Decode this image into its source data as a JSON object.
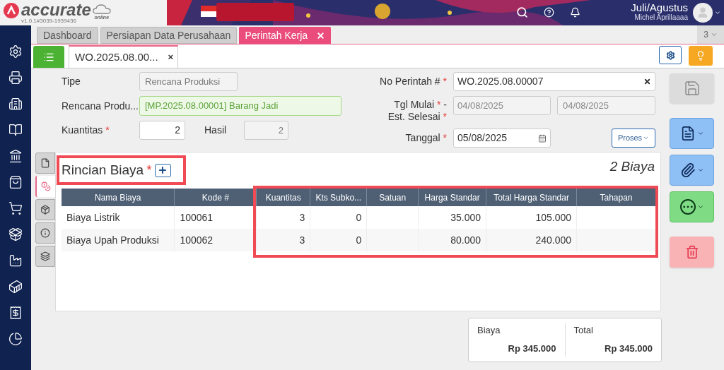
{
  "header": {
    "logo_text": "accurate",
    "logo_sub": "online",
    "version": "v1.0.1#3039-1939436",
    "period": "Juli/Agustus",
    "user": "Michel Aprillaaaa"
  },
  "tabs": [
    {
      "label": "Dashboard",
      "selected": false,
      "closable": false
    },
    {
      "label": "Persiapan Data Perusahaan",
      "selected": false,
      "closable": false
    },
    {
      "label": "Perintah Kerja",
      "selected": true,
      "closable": true
    }
  ],
  "tab_count": "3",
  "doc_tab": {
    "label": "WO.2025.08.00...",
    "close": "×"
  },
  "form": {
    "tipe": {
      "label": "Tipe",
      "value": "Rencana Produksi"
    },
    "rencana": {
      "label": "Rencana Produ...",
      "value": "[MP.2025.08.00001] Barang Jadi"
    },
    "kuantitas": {
      "label": "Kuantitas",
      "required": "*",
      "value": "2"
    },
    "hasil": {
      "label": "Hasil",
      "value": "2"
    },
    "no_perintah": {
      "label": "No Perintah #",
      "required": "*",
      "value": "WO.2025.08.00007"
    },
    "tgl": {
      "label_1": "Tgl Mulai",
      "required_1": "*",
      "label_dash": "-",
      "label_2": "Est. Selesai",
      "required_2": "*",
      "value_start": "04/08/2025",
      "value_end": "04/08/2025"
    },
    "tanggal": {
      "label": "Tanggal",
      "required": "*",
      "value": "05/08/2025"
    },
    "proses_button": "Proses"
  },
  "side_tabs": [
    {
      "selected": false
    },
    {
      "selected": true
    },
    {
      "selected": false
    },
    {
      "selected": false
    },
    {
      "selected": false
    }
  ],
  "section": {
    "title": "Rincian Biaya",
    "required": "*",
    "count": "2 Biaya"
  },
  "table": {
    "columns": [
      "Nama Biaya",
      "Kode #",
      "Kuantitas",
      "Kts Subko...",
      "Satuan",
      "Harga Standar",
      "Total Harga Standar",
      "Tahapan"
    ],
    "rows": [
      [
        "Biaya Listrik",
        "100061",
        "3",
        "0",
        "",
        "35.000",
        "105.000",
        ""
      ],
      [
        "Biaya Upah Produksi",
        "100062",
        "3",
        "0",
        "",
        "80.000",
        "240.000",
        ""
      ]
    ]
  },
  "totals": [
    {
      "label": "Biaya",
      "value": "Rp 345.000"
    },
    {
      "label": "Total",
      "value": "Rp 345.000"
    }
  ]
}
